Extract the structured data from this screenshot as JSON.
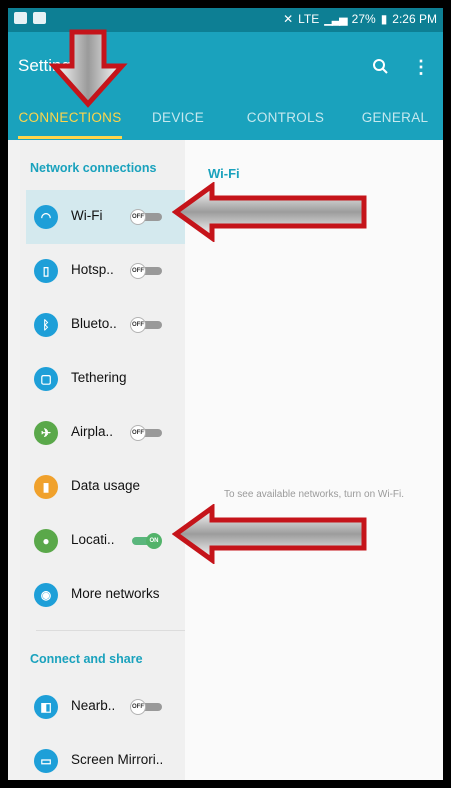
{
  "status_bar": {
    "signal": "LTE",
    "battery": "27%",
    "time": "2:26 PM"
  },
  "app_bar": {
    "title": "Settings"
  },
  "tabs": [
    {
      "label": "CONNECTIONS",
      "active": true
    },
    {
      "label": "DEVICE",
      "active": false
    },
    {
      "label": "CONTROLS",
      "active": false
    },
    {
      "label": "GENERAL",
      "active": false
    }
  ],
  "sidebar": {
    "section_network": "Network connections",
    "section_share": "Connect and share",
    "items": [
      {
        "label": "Wi-Fi",
        "icon": "wifi-icon",
        "color": "#1e9fd8",
        "toggle": "OFF",
        "selected": true
      },
      {
        "label": "Hotsp..",
        "icon": "hotspot-icon",
        "color": "#1e9fd8",
        "toggle": "OFF"
      },
      {
        "label": "Blueto..",
        "icon": "bluetooth-icon",
        "color": "#1e9fd8",
        "toggle": "OFF"
      },
      {
        "label": "Tethering",
        "icon": "tethering-icon",
        "color": "#1e9fd8"
      },
      {
        "label": "Airpla..",
        "icon": "airplane-icon",
        "color": "#5aa84a",
        "toggle": "OFF"
      },
      {
        "label": "Data usage",
        "icon": "data-usage-icon",
        "color": "#f0a12c"
      },
      {
        "label": "Locati..",
        "icon": "location-icon",
        "color": "#5aa84a",
        "toggle": "ON"
      },
      {
        "label": "More networks",
        "icon": "more-networks-icon",
        "color": "#1e9fd8"
      },
      {
        "label": "Nearb..",
        "icon": "nearby-icon",
        "color": "#1e9fd8",
        "toggle": "OFF"
      },
      {
        "label": "Screen Mirrori..",
        "icon": "screen-mirroring-icon",
        "color": "#1e9fd8"
      }
    ]
  },
  "content": {
    "title": "Wi-Fi",
    "message": "To see available networks, turn on Wi-Fi."
  },
  "colors": {
    "accent": "#1aa2bd",
    "tab_active": "#ffd54a",
    "arrow": "#c5141a"
  }
}
